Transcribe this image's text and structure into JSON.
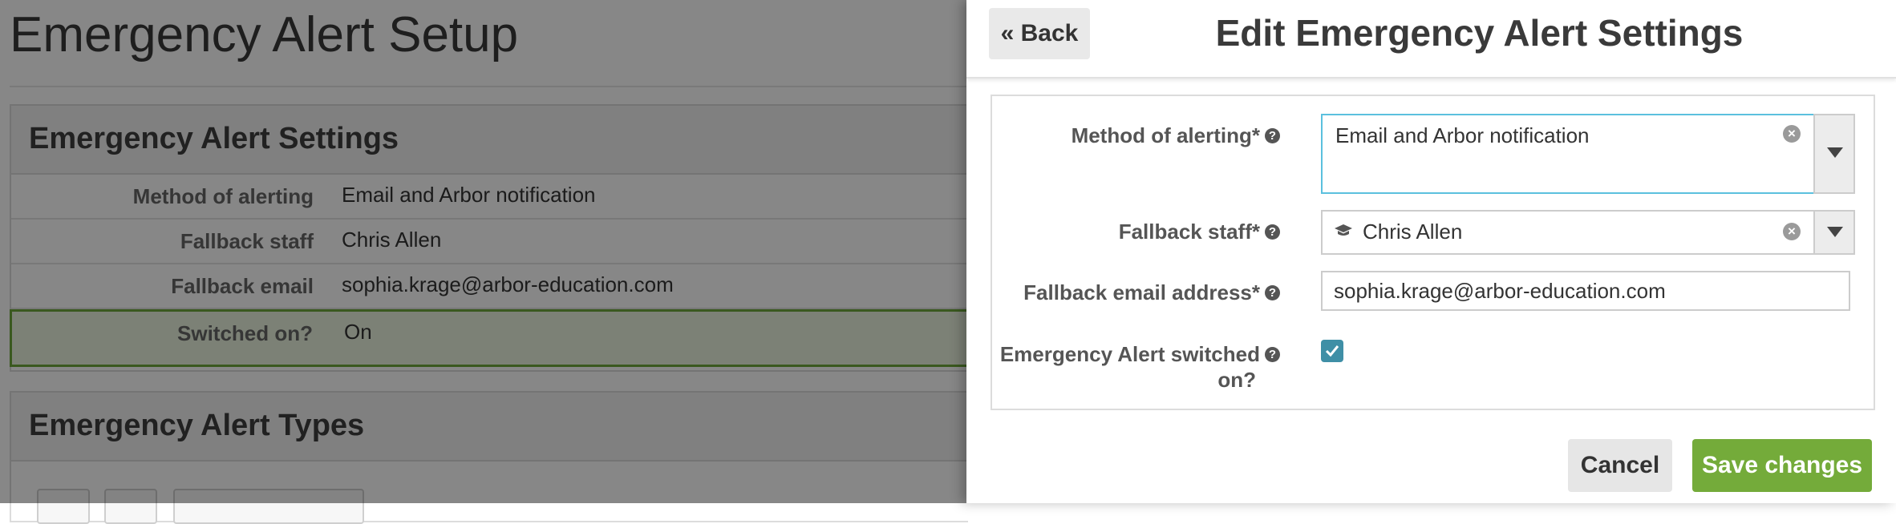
{
  "background": {
    "page_title": "Emergency Alert Setup",
    "settings_panel": {
      "heading": "Emergency Alert Settings",
      "rows": [
        {
          "label": "Method of alerting",
          "value": "Email and Arbor notification"
        },
        {
          "label": "Fallback staff",
          "value": "Chris Allen"
        },
        {
          "label": "Fallback email",
          "value": "sophia.krage@arbor-education.com"
        },
        {
          "label": "Switched on?",
          "value": "On"
        }
      ]
    },
    "types_panel": {
      "heading": "Emergency Alert Types"
    }
  },
  "sheet": {
    "back_label": "« Back",
    "title": "Edit Emergency Alert Settings",
    "form": {
      "method": {
        "label": "Method of alerting*",
        "value": "Email and Arbor notification"
      },
      "fallback_staff": {
        "label": "Fallback staff*",
        "value": "Chris Allen",
        "icon": "graduation-cap-icon"
      },
      "fallback_email": {
        "label": "Fallback email address*",
        "value": "sophia.krage@arbor-education.com"
      },
      "switched_on": {
        "label_line1": "Emergency Alert switched",
        "label_line2": "on?",
        "checked": true
      }
    },
    "cancel_label": "Cancel",
    "save_label": "Save changes"
  },
  "colors": {
    "save_green": "#74ab3a",
    "checkbox_teal": "#3f8fa6",
    "focus_border": "#5bc0de",
    "highlight_row": "#eaf4df"
  }
}
